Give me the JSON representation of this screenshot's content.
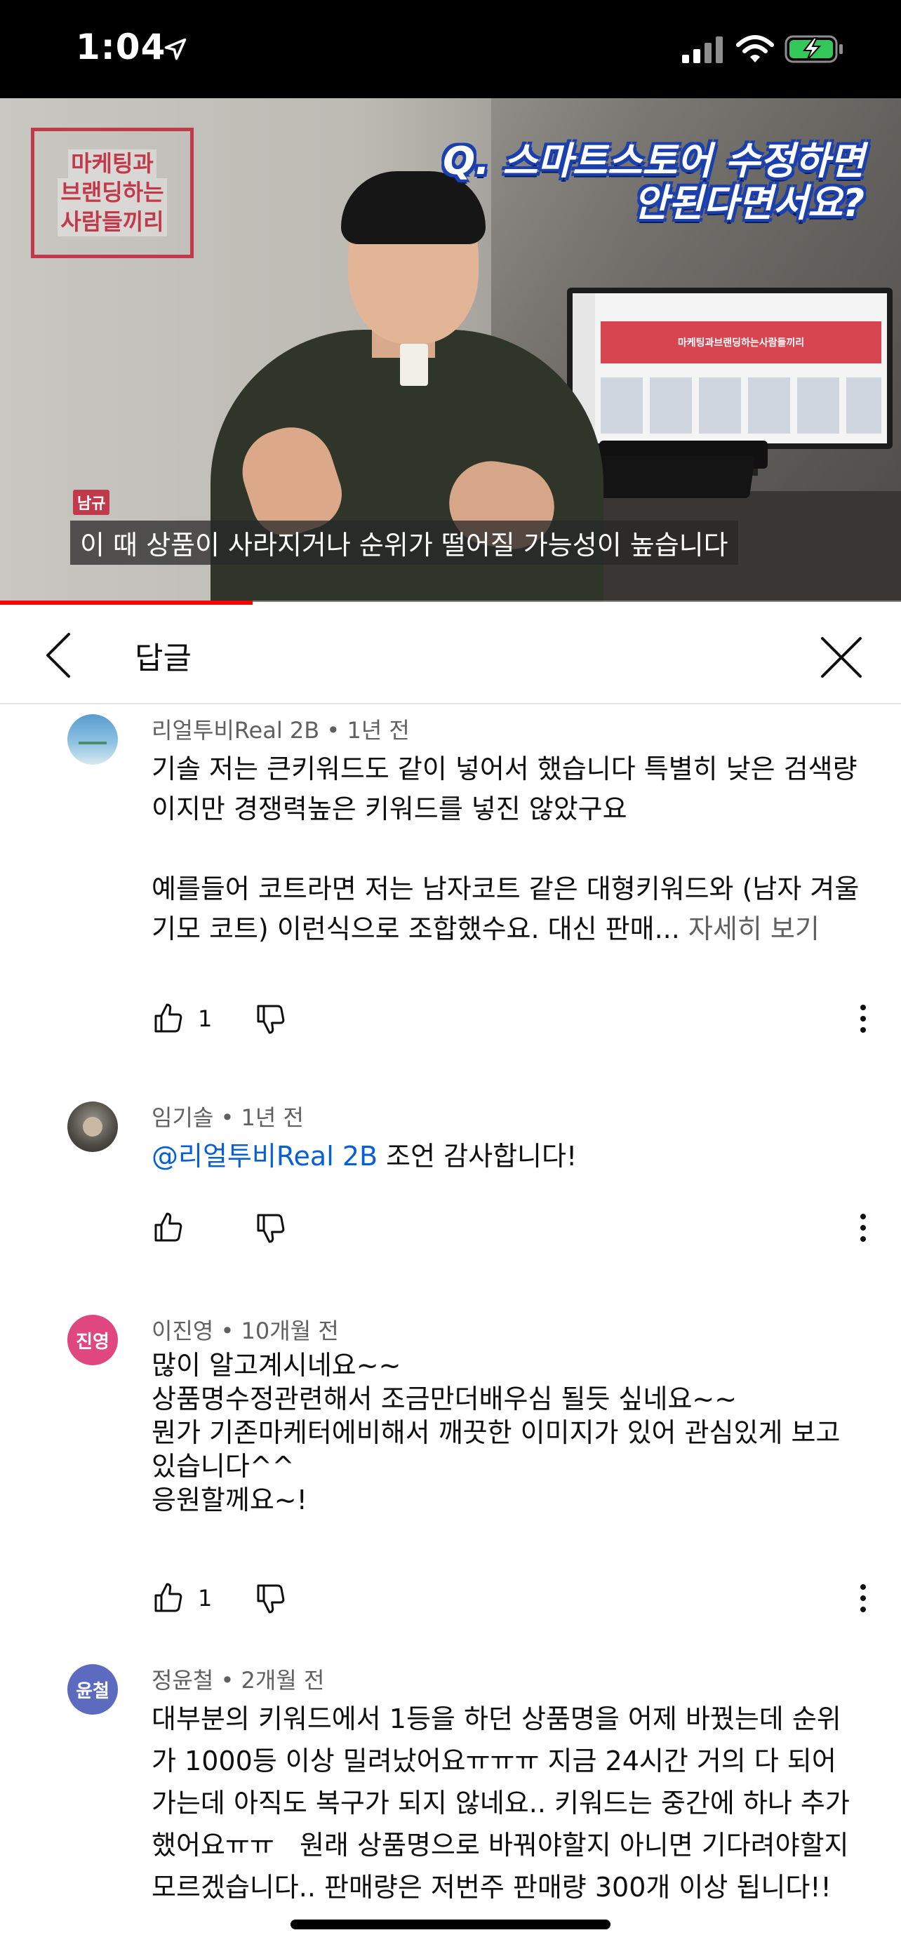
{
  "status_bar": {
    "time": "1:04",
    "icons": [
      "location-arrow-icon",
      "cellular-signal-icon",
      "wifi-icon",
      "battery-charging-icon"
    ],
    "battery_color": "#34c759"
  },
  "video": {
    "channel_logo_lines": [
      "마케팅과",
      "브랜딩하는",
      "사람들끼리"
    ],
    "headline_lines": [
      "Q. 스마트스토어 수정하면",
      "안된다면서요?"
    ],
    "monitor_banner": "마케팅과브랜딩하는사람들끼리",
    "speaker_tag": "남규",
    "caption": "이 때 상품이 사라지거나 순위가 떨어질 가능성이 높습니다",
    "progress": 0.28,
    "accent_color": "#ff0000"
  },
  "header": {
    "title": "답글",
    "back_icon": "chevron-left-icon",
    "close_icon": "close-icon"
  },
  "comments": [
    {
      "author": "리얼투비Real 2B",
      "time": "1년 전",
      "meta_sep": " • ",
      "avatar_text": "",
      "avatar_color": "#6fa3c9",
      "body": "기솔 저는 큰키워드도 같이 넣어서 했습니다 특별히 낮은 검색량이지만 경쟁력높은 키워드를 넣진 않았구요\n\n예를들어 코트라면 저는 남자코트 같은 대형키워드와 (남자 겨울 기모 코트) 이런식으로 조합했수요. 대신 판매...",
      "more_label": " 자세히 보기",
      "likes": "1"
    },
    {
      "author": "임기솔",
      "time": "1년 전",
      "meta_sep": " • ",
      "avatar_text": "",
      "avatar_color": "#5a5a52",
      "mention": "@리얼투비Real 2B",
      "body": " 조언 감사합니다!",
      "likes": ""
    },
    {
      "author": "이진영",
      "time": "10개월 전",
      "meta_sep": " • ",
      "avatar_text": "진영",
      "avatar_color": "#e0467f",
      "body": "많이 알고계시네요~~\n상품명수정관련해서 조금만더배우심 될듯 싶네요~~\n뭔가 기존마케터에비해서 깨끗한 이미지가 있어 관심있게 보고있습니다^^\n응원할께요~!",
      "likes": "1"
    },
    {
      "author": "정윤철",
      "time": "2개월 전",
      "meta_sep": " • ",
      "avatar_text": "윤철",
      "avatar_color": "#5c6bc0",
      "body": "대부분의 키워드에서 1등을 하던 상품명을 어제 바꿨는데 순위가 1000등 이상 밀려났어요ㅠㅠㅠ 지금 24시간 거의 다 되어가는데 아직도 복구가 되지 않네요.. 키워드는 중간에 하나 추가했어요ㅠㅠ   원래 상품명으로 바꿔야할지 아니면 기다려야할지 모르겠습니다.. 판매량은 저번주 판매량 300개 이상 됩니다!!",
      "likes": ""
    }
  ]
}
